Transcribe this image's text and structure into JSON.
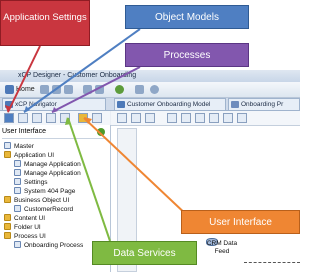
{
  "window": {
    "title": "xCP Designer - Customer Onboarding"
  },
  "toolbar": {
    "home_label": "Home"
  },
  "tabs": [
    {
      "label": "xCP Navigator"
    },
    {
      "label": "Customer Onboarding Model"
    },
    {
      "label": "Onboarding Pr"
    }
  ],
  "navigator": {
    "header": "User Interface",
    "items": [
      {
        "label": "Master"
      },
      {
        "label": "Application UI"
      },
      {
        "label": "Manage Application"
      },
      {
        "label": "Manage Application"
      },
      {
        "label": "Settings"
      },
      {
        "label": "System 404 Page"
      },
      {
        "label": "Business Object UI"
      },
      {
        "label": "CustomerRecord"
      },
      {
        "label": "Content UI"
      },
      {
        "label": "Folder UI"
      },
      {
        "label": "Process UI"
      },
      {
        "label": "Onboarding Process"
      }
    ]
  },
  "canvas": {
    "node_label": "CRM Data Feed"
  },
  "callouts": {
    "application_settings": "Application Settings",
    "object_models": "Object Models",
    "processes": "Processes",
    "user_interface": "User Interface",
    "data_services": "Data Services"
  },
  "colors": {
    "application_settings": "#c9363f",
    "object_models": "#4f7fc2",
    "processes": "#8257ae",
    "user_interface": "#ef8633",
    "data_services": "#7fba42"
  }
}
